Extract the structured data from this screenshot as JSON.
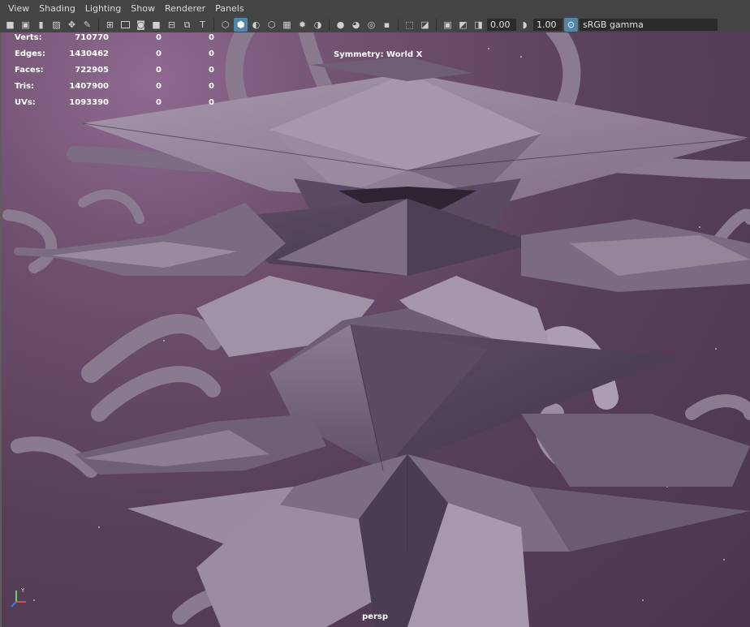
{
  "menubar": {
    "items": [
      "View",
      "Shading",
      "Lighting",
      "Show",
      "Renderer",
      "Panels"
    ]
  },
  "toolbar": {
    "exposure_value": "0.00",
    "gamma_value": "1.00",
    "color_space": "sRGB gamma"
  },
  "hud": {
    "rows": [
      {
        "label": "Verts:",
        "value": "710770",
        "c2": "0",
        "c3": "0"
      },
      {
        "label": "Edges:",
        "value": "1430462",
        "c2": "0",
        "c3": "0"
      },
      {
        "label": "Faces:",
        "value": "722905",
        "c2": "0",
        "c3": "0"
      },
      {
        "label": "Tris:",
        "value": "1407900",
        "c2": "0",
        "c3": "0"
      },
      {
        "label": "UVs:",
        "value": "1093390",
        "c2": "0",
        "c3": "0"
      }
    ],
    "symmetry": "Symmetry: World X",
    "camera": "persp"
  },
  "axis_gizmo": {
    "x": "X",
    "y": "Y",
    "z": "Z"
  },
  "colors": {
    "ui_bg": "#444444",
    "highlight": "#5285a6",
    "background_purple": "#59405a",
    "model_lilac": "#8f7e95",
    "model_dark": "#4d3f54"
  }
}
